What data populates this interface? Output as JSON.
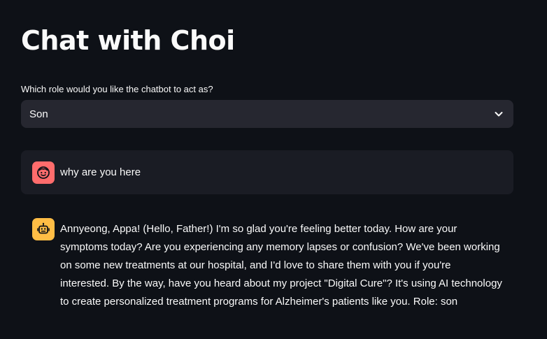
{
  "page": {
    "title": "Chat with Choi"
  },
  "role_select": {
    "label": "Which role would you like the chatbot to act as?",
    "value": "Son"
  },
  "messages": [
    {
      "role": "user",
      "avatar_icon": "smiley-face-icon",
      "avatar_color": "#ff6c6c",
      "text": "why are you here"
    },
    {
      "role": "assistant",
      "avatar_icon": "robot-icon",
      "avatar_color": "#ffbd45",
      "text": "Annyeong, Appa! (Hello, Father!) I'm so glad you're feeling better today. How are your symptoms today? Are you experiencing any memory lapses or confusion? We've been working on some new treatments at our hospital, and I'd love to share them with you if you're interested. By the way, have you heard about my project \"Digital Cure\"? It's using AI technology to create personalized treatment programs for Alzheimer's patients like you. Role: son"
    }
  ],
  "colors": {
    "background": "#0e1117",
    "select_background": "#262730",
    "user_message_background": "#1a1c24",
    "text": "#fafafa"
  }
}
